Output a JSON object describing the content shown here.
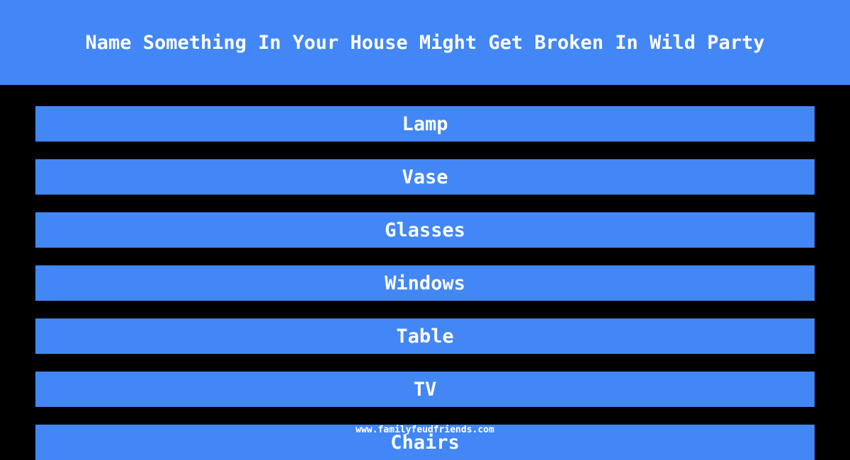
{
  "header": {
    "title": "Name Something In Your House Might Get Broken In Wild Party"
  },
  "answers": [
    {
      "label": "Lamp"
    },
    {
      "label": "Vase"
    },
    {
      "label": "Glasses"
    },
    {
      "label": "Windows"
    },
    {
      "label": "Table"
    },
    {
      "label": "TV"
    },
    {
      "label": "Chairs"
    }
  ],
  "footer": {
    "watermark": "www.familyfeudfriends.com"
  },
  "colors": {
    "accent": "#4287f5",
    "background": "#000000"
  }
}
